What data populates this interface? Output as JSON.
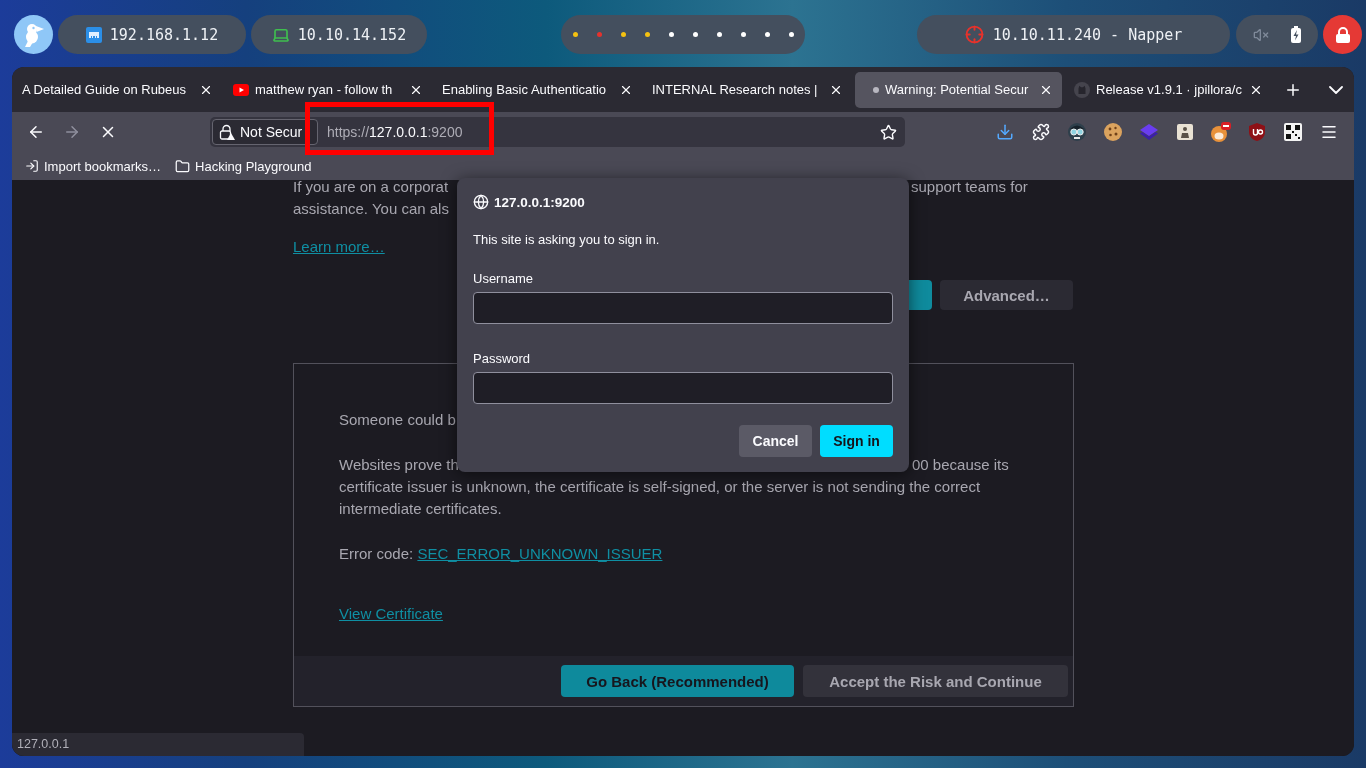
{
  "top_bar": {
    "addresses": [
      {
        "kind": "lan",
        "text": "192.168.1.12"
      },
      {
        "kind": "vpn",
        "text": "10.10.14.152"
      }
    ],
    "workspaces": [
      {
        "color": "#f5c211"
      },
      {
        "color": "#e5322d"
      },
      {
        "color": "#f5c211"
      },
      {
        "color": "#f5c211"
      },
      {
        "color": "#ffffff"
      },
      {
        "color": "#ffffff"
      },
      {
        "color": "#ffffff"
      },
      {
        "color": "#ffffff"
      },
      {
        "color": "#ffffff"
      },
      {
        "color": "#ffffff"
      }
    ],
    "target": "10.10.11.240 - Napper",
    "sound_muted": true
  },
  "tabs": [
    {
      "title": "A Detailed Guide on Rubeus",
      "kind": "plain",
      "selected": false
    },
    {
      "title": "matthew ryan - follow th",
      "kind": "video",
      "selected": false
    },
    {
      "title": "Enabling Basic Authenticatio",
      "kind": "plain",
      "selected": false
    },
    {
      "title": "INTERNAL Research notes |",
      "kind": "plain",
      "selected": false
    },
    {
      "title": "Warning: Potential Secur",
      "kind": "loading",
      "selected": true
    },
    {
      "title": "Release v1.9.1 · jpillora/c",
      "kind": "code",
      "selected": false
    }
  ],
  "navigation": [
    {
      "kind": "back",
      "disabled": false
    },
    {
      "kind": "forward",
      "disabled": true
    },
    {
      "kind": "stop",
      "disabled": false
    }
  ],
  "address_bar": {
    "security_label": "Not Secur",
    "scheme": "https://",
    "host": "127.0.0.1",
    "port": ":9200",
    "highlighted": true
  },
  "bookmarks": [
    {
      "kind": "import",
      "label": "Import bookmarks…"
    },
    {
      "kind": "folder",
      "label": "Hacking Playground"
    }
  ],
  "page": {
    "intro_lines": [
      {
        "left": "If you are on a corporat",
        "right": "support teams for"
      },
      {
        "left": "assistance. You can als"
      }
    ],
    "learn_more": "Learn more…",
    "advanced_button": "Advanced…",
    "details": {
      "first_line": "Someone could b",
      "paragraph": {
        "left": "Websites prove th",
        "right": "00 because its",
        "rest": "certificate issuer is unknown, the certificate is self-signed, or the server is not sending the correct intermediate certificates."
      },
      "error_label": "Error code:",
      "error_code": "SEC_ERROR_UNKNOWN_ISSUER",
      "view_certificate": "View Certificate",
      "buttons": [
        {
          "label": "Go Back (Recommended)",
          "kind": "primary"
        },
        {
          "label": "Accept the Risk and Continue",
          "kind": "secondary"
        }
      ]
    }
  },
  "auth_dialog": {
    "origin": "127.0.0.1:9200",
    "message": "This site is asking you to sign in.",
    "fields": [
      {
        "label": "Username"
      },
      {
        "label": "Password"
      }
    ],
    "buttons": [
      {
        "label": "Cancel",
        "kind": "secondary"
      },
      {
        "label": "Sign in",
        "kind": "primary"
      }
    ]
  },
  "status_text": "127.0.0.1"
}
